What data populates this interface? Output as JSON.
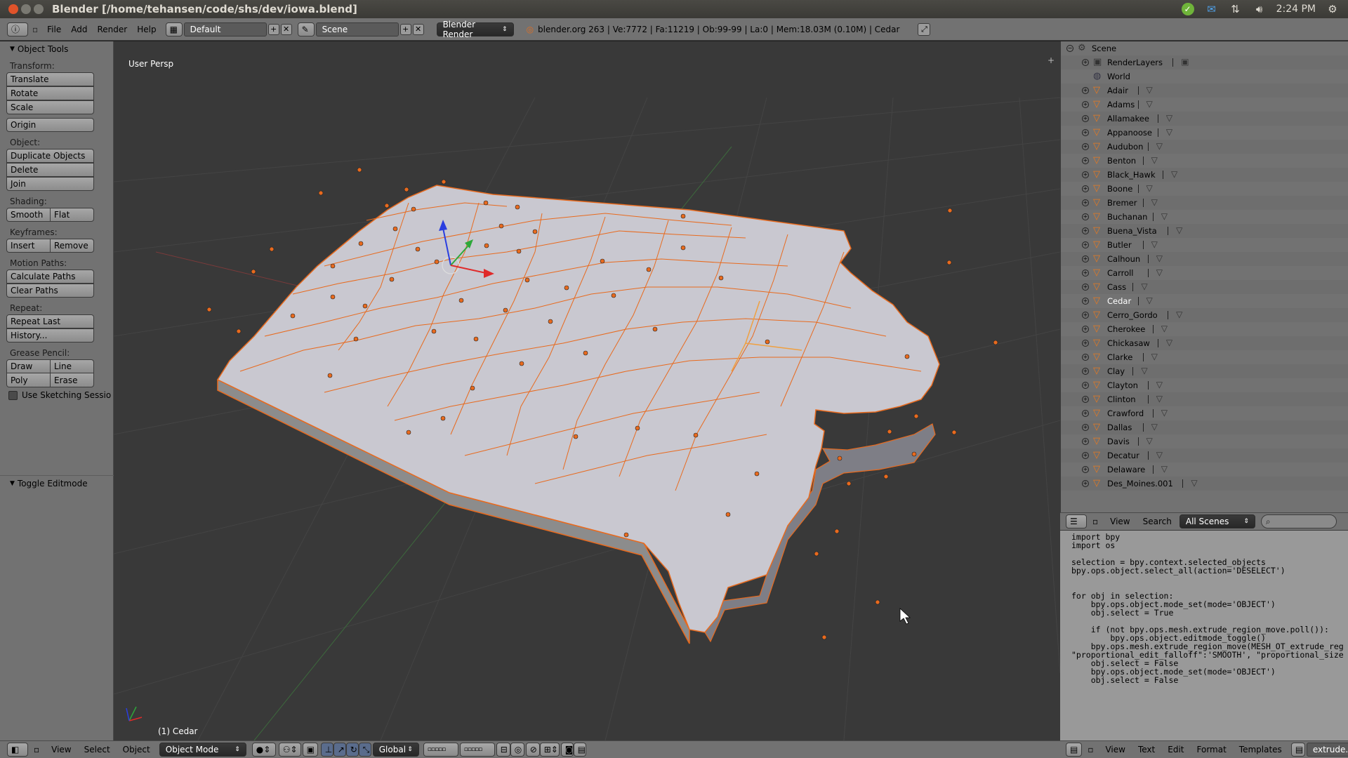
{
  "window": {
    "title": "Blender [/home/tehansen/code/shs/dev/iowa.blend]",
    "clock": "2:24 PM"
  },
  "info_header": {
    "menus": [
      "File",
      "Add",
      "Render",
      "Help"
    ],
    "screen_layout": "Default",
    "scene": "Scene",
    "render_engine": "Blender Render",
    "stats": "blender.org 263 | Ve:7772 | Fa:11219 | Ob:99-99 | La:0 | Mem:18.03M (0.10M) | Cedar"
  },
  "tool_shelf": {
    "title": "Object Tools",
    "transform_label": "Transform:",
    "translate": "Translate",
    "rotate": "Rotate",
    "scale": "Scale",
    "origin": "Origin",
    "object_label": "Object:",
    "duplicate": "Duplicate Objects",
    "delete": "Delete",
    "join": "Join",
    "shading_label": "Shading:",
    "smooth": "Smooth",
    "flat": "Flat",
    "keyframes_label": "Keyframes:",
    "insert": "Insert",
    "remove": "Remove",
    "motion_paths_label": "Motion Paths:",
    "calculate_paths": "Calculate Paths",
    "clear_paths": "Clear Paths",
    "repeat_label": "Repeat:",
    "repeat_last": "Repeat Last",
    "history": "History...",
    "grease_pencil_label": "Grease Pencil:",
    "draw": "Draw",
    "line": "Line",
    "poly": "Poly",
    "erase": "Erase",
    "use_sketching": "Use Sketching Sessio",
    "toggle_editmode": "Toggle Editmode"
  },
  "viewport": {
    "view_label": "User Persp",
    "object_label": "(1) Cedar",
    "header": {
      "menus": [
        "View",
        "Select",
        "Object"
      ],
      "mode": "Object Mode",
      "orientation": "Global"
    }
  },
  "outliner": {
    "scene": "Scene",
    "render_layers": "RenderLayers",
    "world": "World",
    "objects": [
      "Adair",
      "Adams",
      "Allamakee",
      "Appanoose",
      "Audubon",
      "Benton",
      "Black_Hawk",
      "Boone",
      "Bremer",
      "Buchanan",
      "Buena_Vista",
      "Butler",
      "Calhoun",
      "Carroll",
      "Cass",
      "Cedar",
      "Cerro_Gordo",
      "Cherokee",
      "Chickasaw",
      "Clarke",
      "Clay",
      "Clayton",
      "Clinton",
      "Crawford",
      "Dallas",
      "Davis",
      "Decatur",
      "Delaware",
      "Des_Moines.001"
    ],
    "selected": "Cedar",
    "header": {
      "view": "View",
      "search": "Search",
      "filter": "All Scenes"
    }
  },
  "text_editor": {
    "lines": [
      "import bpy",
      "import os",
      "",
      "selection = bpy.context.selected_objects",
      "bpy.ops.object.select_all(action='DESELECT')",
      "",
      "",
      "for obj in selection:",
      "    bpy.ops.object.mode_set(mode='OBJECT')",
      "    obj.select = True",
      "",
      "    if (not bpy.ops.mesh.extrude_region_move.poll()):",
      "        bpy.ops.object.editmode_toggle()",
      "    bpy.ops.mesh.extrude_region_move(MESH_OT_extrude_reg",
      "\"proportional_edit_falloff\":'SMOOTH', \"proportional_size",
      "    obj.select = False",
      "    bpy.ops.object.mode_set(mode='OBJECT')",
      "    obj.select = False"
    ],
    "header": {
      "menus": [
        "View",
        "Text",
        "Edit",
        "Format",
        "Templates"
      ],
      "filename": "extrude.py"
    }
  },
  "colors": {
    "selection_orange": "#e86a1e",
    "map_surface": "#c9c8d0",
    "viewport_bg": "#393939",
    "panel_bg": "#727272"
  }
}
